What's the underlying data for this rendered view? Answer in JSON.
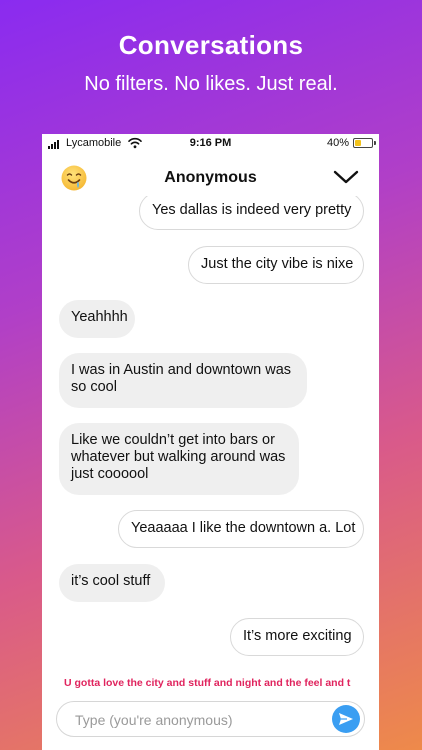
{
  "promo": {
    "title": "Conversations",
    "subtitle": "No filters. No likes. Just real."
  },
  "status_bar": {
    "carrier": "Lycamobile",
    "time": "9:16 PM",
    "battery_percent": "40%",
    "battery_level": 0.4
  },
  "header": {
    "title": "Anonymous",
    "left_icon": "drooling-face-emoji-icon",
    "right_icon": "chevron-down-icon"
  },
  "messages": [
    {
      "text": "Yes dallas is indeed very pretty",
      "side": "out"
    },
    {
      "text": "Just the city vibe is nixe",
      "side": "out"
    },
    {
      "text": "Yeahhhh",
      "side": "in"
    },
    {
      "text": "I was in Austin and downtown was so cool",
      "side": "in"
    },
    {
      "text": "Like we couldn’t get into bars or whatever but walking around was just coooool",
      "side": "in"
    },
    {
      "text": "Yeaaaaa I like the downtown a. Lot",
      "side": "out"
    },
    {
      "text": "it’s cool stuff",
      "side": "in"
    },
    {
      "text": "It’s more exciting",
      "side": "out"
    }
  ],
  "typing": {
    "text": "U gotta love the city and stuff and night and the feel and t"
  },
  "composer": {
    "placeholder": "Type (you're anonymous)",
    "value": "",
    "send_icon": "send-arrow-icon"
  },
  "colors": {
    "gradient_start": "#8a2bf0",
    "gradient_end": "#ee8a4a",
    "typing_text": "#e0245e",
    "send_button": "#3a9ef2",
    "incoming_bubble": "#efefef",
    "battery": "#f2c21a"
  }
}
